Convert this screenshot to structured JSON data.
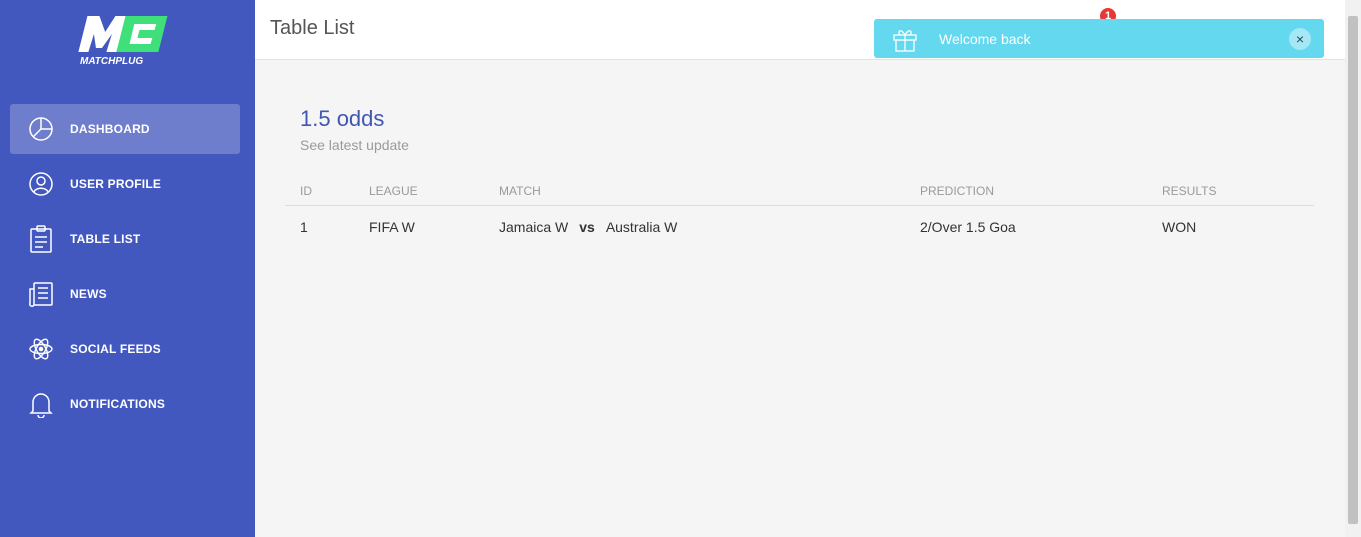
{
  "brand": {
    "logo_text": "MATCHPLUG",
    "logo_mark": "M",
    "accent": "#3fe07a"
  },
  "sidebar": {
    "items": [
      {
        "label": "DASHBOARD",
        "icon": "chart-pie-icon",
        "active": true
      },
      {
        "label": "USER PROFILE",
        "icon": "user-circle-icon",
        "active": false
      },
      {
        "label": "TABLE LIST",
        "icon": "clipboard-icon",
        "active": false
      },
      {
        "label": "NEWS",
        "icon": "newspaper-icon",
        "active": false
      },
      {
        "label": "SOCIAL FEEDS",
        "icon": "atom-icon",
        "active": false
      },
      {
        "label": "NOTIFICATIONS",
        "icon": "bell-icon",
        "active": false
      }
    ]
  },
  "header": {
    "title": "Table List",
    "notification_count": "1"
  },
  "toast": {
    "message": "Welcome back",
    "close": "×",
    "icon": "gift-icon"
  },
  "card": {
    "title": "1.5 odds",
    "subtitle": "See latest update",
    "columns": [
      "ID",
      "LEAGUE",
      "MATCH",
      "PREDICTION",
      "RESULTS"
    ],
    "rows": [
      {
        "id": "1",
        "league": "FIFA W",
        "home": "Jamaica W",
        "vs": "vs",
        "away": "Australia W",
        "prediction": "2/Over 1.5 Goa",
        "result": "WON"
      }
    ]
  },
  "colors": {
    "sidebar": "#4358bf",
    "title": "#3f56b5",
    "toast": "#63d8ef",
    "badge": "#e53935"
  }
}
